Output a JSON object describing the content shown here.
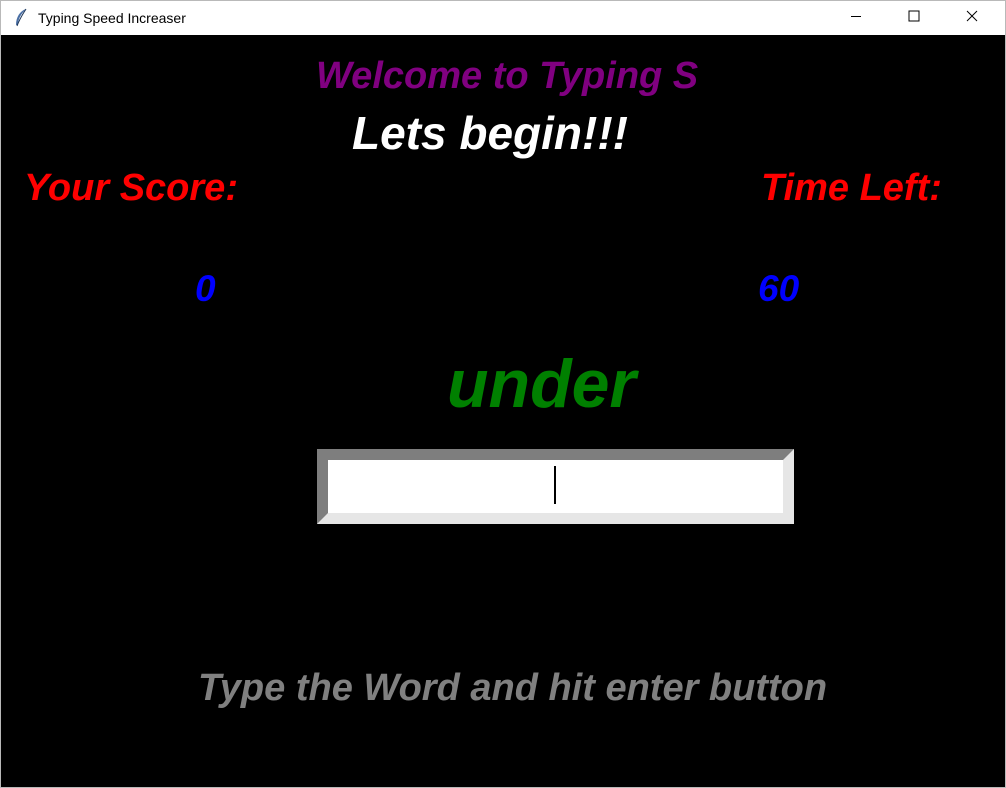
{
  "window": {
    "title": "Typing Speed Increaser",
    "icon": "feather-icon",
    "controls": {
      "minimize": "minimize-icon",
      "maximize": "maximize-icon",
      "close": "close-icon"
    }
  },
  "app": {
    "welcome": "Welcome to Typing S",
    "begin": "Lets begin!!!",
    "score_label": "Your Score:",
    "time_label": "Time Left:",
    "score_value": "0",
    "time_value": "60",
    "word": "under",
    "entry_value": "",
    "instruction": "Type the Word and hit enter button"
  },
  "colors": {
    "background": "#000000",
    "welcome": "#800080",
    "begin": "#ffffff",
    "labels": "#ff0000",
    "values": "#0000ff",
    "word": "#008000",
    "instruction": "#808080"
  }
}
